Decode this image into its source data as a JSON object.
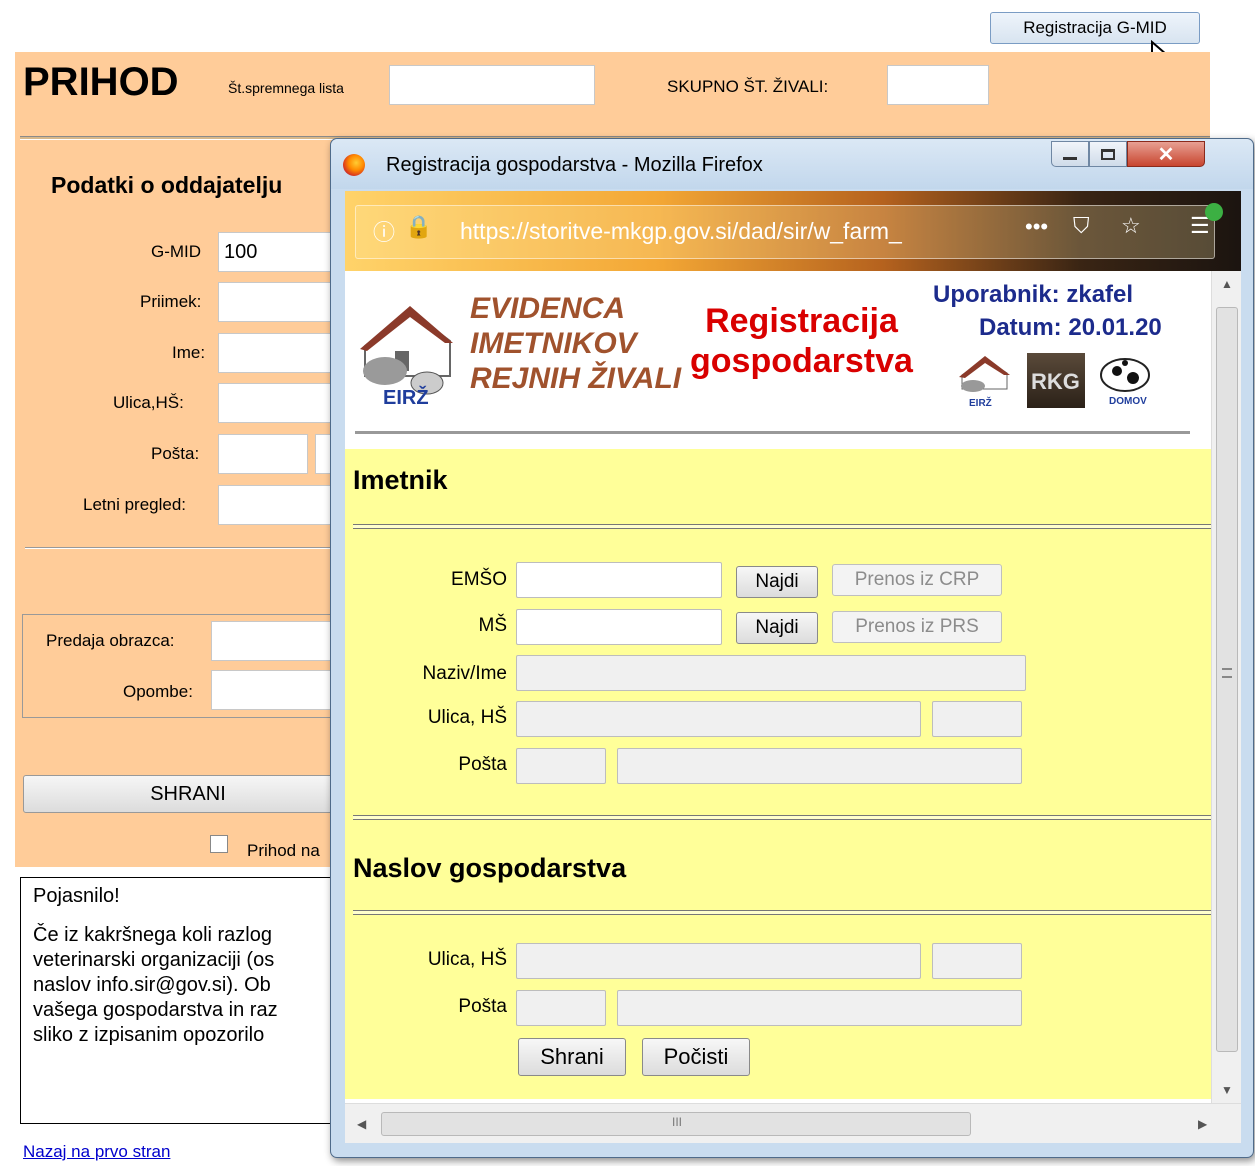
{
  "top_button": "Registracija G-MID",
  "prihod": {
    "title": "PRIHOD",
    "spremni_list_label": "Št.spremnega lista",
    "skupno_label": "SKUPNO ŠT. ŽIVALI:",
    "section_title": "Podatki o oddajatelju",
    "gmid_label": "G-MID",
    "gmid_value": "100",
    "priimek_label": "Priimek:",
    "ime_label": "Ime:",
    "ulica_label": "Ulica,HŠ:",
    "posta_label": "Pošta:",
    "letni_label": "Letni pregled:",
    "predaja_label": "Predaja obrazca:",
    "opombe_label": "Opombe:",
    "shrani": "SHRANI",
    "checkbox_label": "Prihod na"
  },
  "info": {
    "heading": "Pojasnilo!",
    "lines": [
      "Če iz kakršnega koli razlog",
      "veterinarski organizaciji (os",
      "naslov info.sir@gov.si). Ob",
      "vašega gospodarstva in raz",
      "sliko z izpisanim opozorilo"
    ]
  },
  "back_link": "Nazaj na prvo stran",
  "popup": {
    "title": "Registracija gospodarstva - Mozilla Firefox",
    "url": "https://storitve-mkgp.gov.si/dad/sir/w_farm_",
    "logo_text": "EIRŽ",
    "evidenca": [
      "EVIDENCA",
      "IMETNIKOV",
      "REJNIH ŽIVALI"
    ],
    "reg_title": [
      "Registracija",
      "gospodarstva"
    ],
    "user_label": "Uporabnik:",
    "user_value": "zkafel",
    "datum_label": "Datum:",
    "datum_value": "20.01.20",
    "mini_logos": [
      "EIRŽ",
      "RKG",
      "DOMOV"
    ],
    "imetnik": {
      "heading": "Imetnik",
      "emso_label": "EMŠO",
      "ms_label": "MŠ",
      "najdi": "Najdi",
      "prenos_crp": "Prenos iz CRP",
      "prenos_prs": "Prenos iz PRS",
      "naziv_label": "Naziv/Ime",
      "ulica_label": "Ulica, HŠ",
      "posta_label": "Pošta"
    },
    "naslov": {
      "heading": "Naslov gospodarstva",
      "ulica_label": "Ulica, HŠ",
      "posta_label": "Pošta",
      "shrani": "Shrani",
      "pocisti": "Počisti"
    },
    "scroll_glyph": "III"
  }
}
